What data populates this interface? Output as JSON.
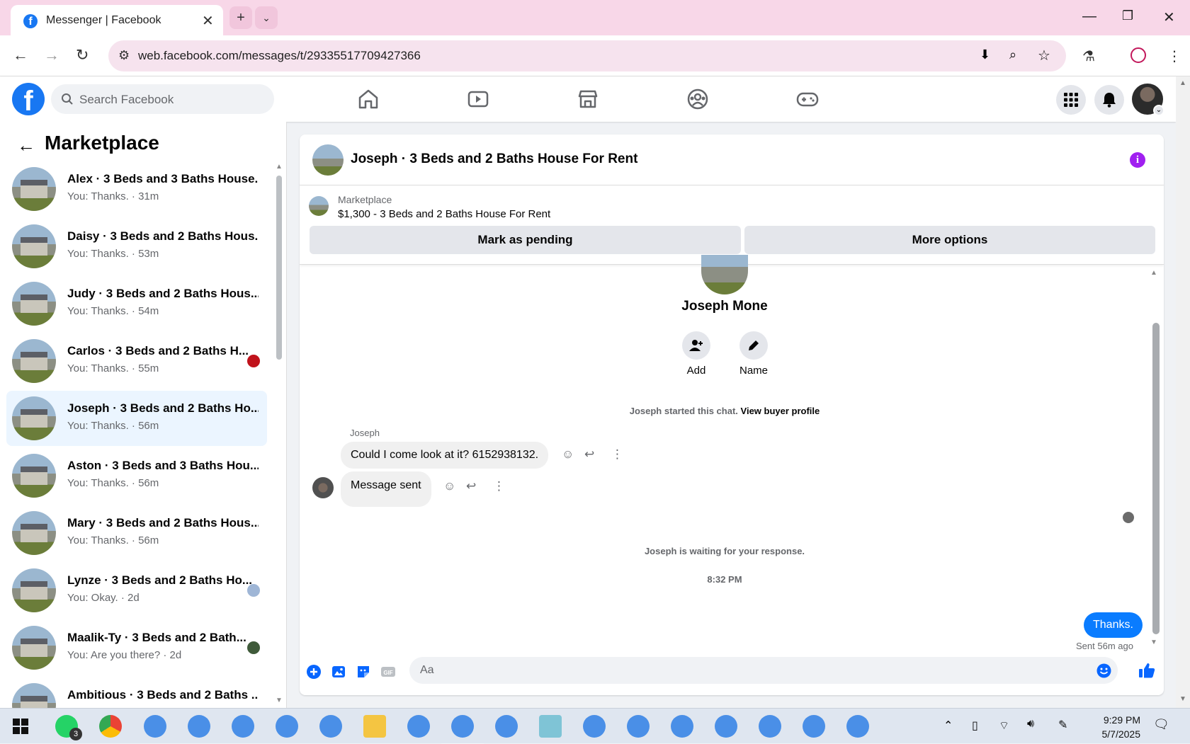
{
  "browser": {
    "tab_title": "Messenger | Facebook",
    "url": "web.facebook.com/messages/t/29335517709427366"
  },
  "header": {
    "search_placeholder": "Search Facebook",
    "nav_icons": [
      "home-icon",
      "video-icon",
      "marketplace-icon",
      "groups-icon",
      "gaming-icon"
    ],
    "brand_color": "#1877f2"
  },
  "sidebar": {
    "title": "Marketplace",
    "conversations": [
      {
        "name": "Alex · 3 Beds and 3 Baths House...",
        "sub": "You: Thanks. · 31m",
        "active": false
      },
      {
        "name": "Daisy · 3 Beds and 2 Baths Hous...",
        "sub": "You: Thanks. · 53m",
        "active": false
      },
      {
        "name": "Judy · 3 Beds and 2 Baths Hous...",
        "sub": "You: Thanks. · 54m",
        "active": false
      },
      {
        "name": "Carlos · 3 Beds and 2 Baths H...",
        "sub": "You: Thanks. · 55m",
        "active": false
      },
      {
        "name": "Joseph · 3 Beds and 2 Baths Ho...",
        "sub": "You: Thanks. · 56m",
        "active": true
      },
      {
        "name": "Aston · 3 Beds and 3 Baths Hou...",
        "sub": "You: Thanks. · 56m",
        "active": false
      },
      {
        "name": "Mary · 3 Beds and 2 Baths Hous...",
        "sub": "You: Thanks. · 56m",
        "active": false
      },
      {
        "name": "Lynze · 3 Beds and 2 Baths Ho...",
        "sub": "You: Okay. · 2d",
        "active": false
      },
      {
        "name": "Maalik-Ty · 3 Beds and 2 Bath...",
        "sub": "You: Are you there? · 2d",
        "active": false
      },
      {
        "name": "Ambitious · 3 Beds and 2 Baths ...",
        "sub": "",
        "active": false
      }
    ]
  },
  "chat": {
    "title": "Joseph · 3 Beds and 2 Baths House For Rent",
    "listing_category": "Marketplace",
    "listing_price_title": "$1,300 - 3 Beds and 2 Baths House For Rent",
    "mark_pending": "Mark as pending",
    "more_options": "More options",
    "profile_name": "Joseph Mone",
    "add_label": "Add",
    "name_label": "Name",
    "started_note": "Joseph started this chat.",
    "view_buyer": "View buyer profile",
    "sender_label": "Joseph",
    "msg1": "Could I come look at it? 6152938132.",
    "msg2": "Message sent",
    "waiting_note": "Joseph is waiting for your response.",
    "timestamp": "8:32 PM",
    "out_msg": "Thanks.",
    "sent_status": "Sent 56m ago",
    "composer_placeholder": "Aa",
    "accent_color": "#0a7cff"
  },
  "taskbar": {
    "time": "9:29 PM",
    "date": "5/7/2025",
    "whatsapp_badge": "3"
  }
}
